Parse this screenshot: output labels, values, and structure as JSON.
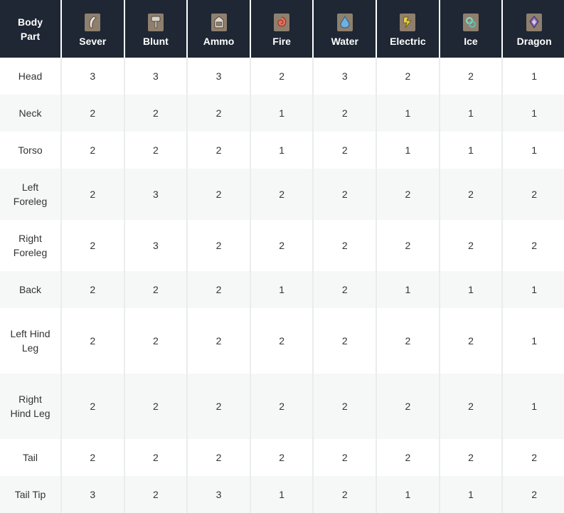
{
  "table": {
    "body_part_header": "Body Part",
    "columns": [
      {
        "label": "Sever",
        "icon": "sever-icon"
      },
      {
        "label": "Blunt",
        "icon": "blunt-icon"
      },
      {
        "label": "Ammo",
        "icon": "ammo-icon"
      },
      {
        "label": "Fire",
        "icon": "fire-icon"
      },
      {
        "label": "Water",
        "icon": "water-icon"
      },
      {
        "label": "Electric",
        "icon": "electric-icon"
      },
      {
        "label": "Ice",
        "icon": "ice-icon"
      },
      {
        "label": "Dragon",
        "icon": "dragon-icon"
      }
    ],
    "rows": [
      {
        "part": "Head",
        "values": [
          "3",
          "3",
          "3",
          "2",
          "3",
          "2",
          "2",
          "1"
        ]
      },
      {
        "part": "Neck",
        "values": [
          "2",
          "2",
          "2",
          "1",
          "2",
          "1",
          "1",
          "1"
        ]
      },
      {
        "part": "Torso",
        "values": [
          "2",
          "2",
          "2",
          "1",
          "2",
          "1",
          "1",
          "1"
        ]
      },
      {
        "part": "Left Foreleg",
        "values": [
          "2",
          "3",
          "2",
          "2",
          "2",
          "2",
          "2",
          "2"
        ]
      },
      {
        "part": "Right Foreleg",
        "values": [
          "2",
          "3",
          "2",
          "2",
          "2",
          "2",
          "2",
          "2"
        ]
      },
      {
        "part": "Back",
        "values": [
          "2",
          "2",
          "2",
          "1",
          "2",
          "1",
          "1",
          "1"
        ]
      },
      {
        "part": "Left Hind Leg",
        "values": [
          "2",
          "2",
          "2",
          "2",
          "2",
          "2",
          "2",
          "1"
        ]
      },
      {
        "part": "Right Hind Leg",
        "values": [
          "2",
          "2",
          "2",
          "2",
          "2",
          "2",
          "2",
          "1"
        ]
      },
      {
        "part": "Tail",
        "values": [
          "2",
          "2",
          "2",
          "2",
          "2",
          "2",
          "2",
          "2"
        ]
      },
      {
        "part": "Tail Tip",
        "values": [
          "3",
          "2",
          "3",
          "1",
          "2",
          "1",
          "1",
          "2"
        ]
      }
    ]
  },
  "colors": {
    "header_bg": "#1e2733",
    "header_text": "#ffffff",
    "row_alt_bg": "#f6f8f7",
    "cell_text": "#333333",
    "icon_bg": "#8f7f6e"
  }
}
